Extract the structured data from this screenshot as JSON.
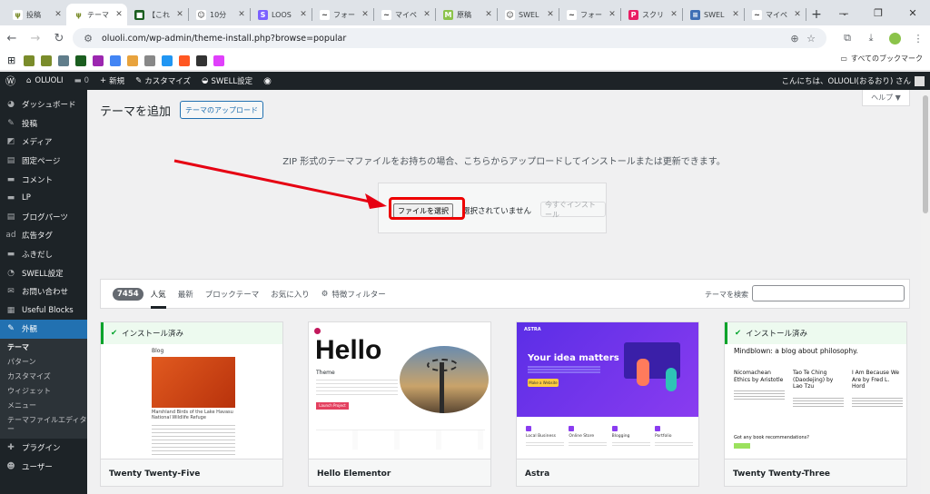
{
  "browser": {
    "tabs": [
      {
        "title": "投稿",
        "color": "#fff",
        "fg": "#7a8c2b",
        "glyph": "ψ"
      },
      {
        "title": "テーマ",
        "color": "#fff",
        "fg": "#7a8c2b",
        "glyph": "ψ",
        "active": true
      },
      {
        "title": "【これ",
        "color": "#1b5e20",
        "fg": "#fff",
        "glyph": "■"
      },
      {
        "title": "10分",
        "color": "#fff",
        "fg": "#333",
        "glyph": "☺"
      },
      {
        "title": "LOOS",
        "color": "#7b61ff",
        "fg": "#fff",
        "glyph": "S"
      },
      {
        "title": "フォー",
        "color": "#fff",
        "fg": "#222",
        "glyph": "~"
      },
      {
        "title": "マイペ",
        "color": "#fff",
        "fg": "#222",
        "glyph": "~"
      },
      {
        "title": "原稿",
        "color": "#8bc34a",
        "fg": "#fff",
        "glyph": "M"
      },
      {
        "title": "SWEL",
        "color": "#fff",
        "fg": "#333",
        "glyph": "☺"
      },
      {
        "title": "フォー",
        "color": "#fff",
        "fg": "#222",
        "glyph": "~"
      },
      {
        "title": "スクリ",
        "color": "#e91e63",
        "fg": "#fff",
        "glyph": "P"
      },
      {
        "title": "SWEL",
        "color": "#3f6fb5",
        "fg": "#fff",
        "glyph": "≡"
      },
      {
        "title": "マイペ",
        "color": "#fff",
        "fg": "#222",
        "glyph": "~"
      }
    ],
    "new_tab": "+",
    "window_controls": {
      "tab_search": "⌄",
      "minimize": "—",
      "maximize": "❐",
      "close": "✕"
    },
    "url": "oluoli.com/wp-admin/theme-install.php?browse=popular",
    "all_bookmarks": "すべてのブックマーク",
    "bookmark_colors": [
      "#7a8c2b",
      "#7a8c2b",
      "#607d8b",
      "#1b5e20",
      "#9c27b0",
      "#4285f4",
      "#e8a33d",
      "#888",
      "#2196f3",
      "#ff5722",
      "#333",
      "#e040fb"
    ]
  },
  "wp_admin_bar": {
    "site_name": "OLUOLI",
    "comments_count": "0",
    "new_label": "新規",
    "customize_label": "カスタマイズ",
    "swell_label": "SWELL設定",
    "howdy": "こんにちは、OLUOLI(おるおり) さん"
  },
  "sidebar": {
    "items": [
      {
        "icon": "◕",
        "label": "ダッシュボード"
      },
      {
        "icon": "✎",
        "label": "投稿"
      },
      {
        "icon": "◩",
        "label": "メディア"
      },
      {
        "icon": "▤",
        "label": "固定ページ"
      },
      {
        "icon": "▬",
        "label": "コメント"
      },
      {
        "icon": "▬",
        "label": "LP"
      },
      {
        "icon": "▤",
        "label": "ブログパーツ"
      },
      {
        "icon": "ad",
        "label": "広告タグ"
      },
      {
        "icon": "▬",
        "label": "ふきだし"
      },
      {
        "icon": "◔",
        "label": "SWELL設定"
      },
      {
        "icon": "✉",
        "label": "お問い合わせ"
      },
      {
        "icon": "▦",
        "label": "Useful Blocks"
      }
    ],
    "appearance": {
      "icon": "✎",
      "label": "外観"
    },
    "appearance_sub": [
      "テーマ",
      "パターン",
      "カスタマイズ",
      "ウィジェット",
      "メニュー",
      "テーマファイルエディター"
    ],
    "after": [
      {
        "icon": "✚",
        "label": "プラグイン"
      },
      {
        "icon": "☻",
        "label": "ユーザー"
      }
    ]
  },
  "page": {
    "title": "テーマを追加",
    "upload_button": "テーマのアップロード",
    "help_button": "ヘルプ ▼",
    "upload_info": "ZIP 形式のテーマファイルをお持ちの場合、こちらからアップロードしてインストールまたは更新できます。",
    "choose_file": "ファイルを選択",
    "no_file": "選択されていません",
    "install_now": "今すぐインストール"
  },
  "filter": {
    "count": "7454",
    "tabs": [
      "人気",
      "最新",
      "ブロックテーマ",
      "お気に入り"
    ],
    "feature_filter": "特徴フィルター",
    "search_label": "テーマを検索"
  },
  "themes": [
    {
      "name": "Twenty Twenty-Five",
      "installed": true,
      "installed_label": "インストール済み",
      "preview_heading": "Blog",
      "preview_caption": "Marshland Birds of the Lake Havasu National Wildlife Refuge"
    },
    {
      "name": "Hello Elementor",
      "installed": false,
      "preview_heading": "Hello",
      "preview_sub": "Theme",
      "preview_button": "Launch Project"
    },
    {
      "name": "Astra",
      "installed": false,
      "preview_logo": "ASTRA",
      "preview_heading": "Your idea matters",
      "preview_button": "Make a Website",
      "preview_features": [
        "Local Business",
        "Online Store",
        "Blogging",
        "Portfolio"
      ]
    },
    {
      "name": "Twenty Twenty-Three",
      "installed": true,
      "installed_label": "インストール済み",
      "preview_heading": "Mindblown: a blog about philosophy.",
      "preview_cols": [
        "Nicomachean Ethics by Aristotle",
        "Tao Te Ching (Daodejing) by Lao Tzu",
        "I Am Because We Are by Fred L. Hord"
      ],
      "preview_footer": "Got any book recommendations?"
    }
  ]
}
